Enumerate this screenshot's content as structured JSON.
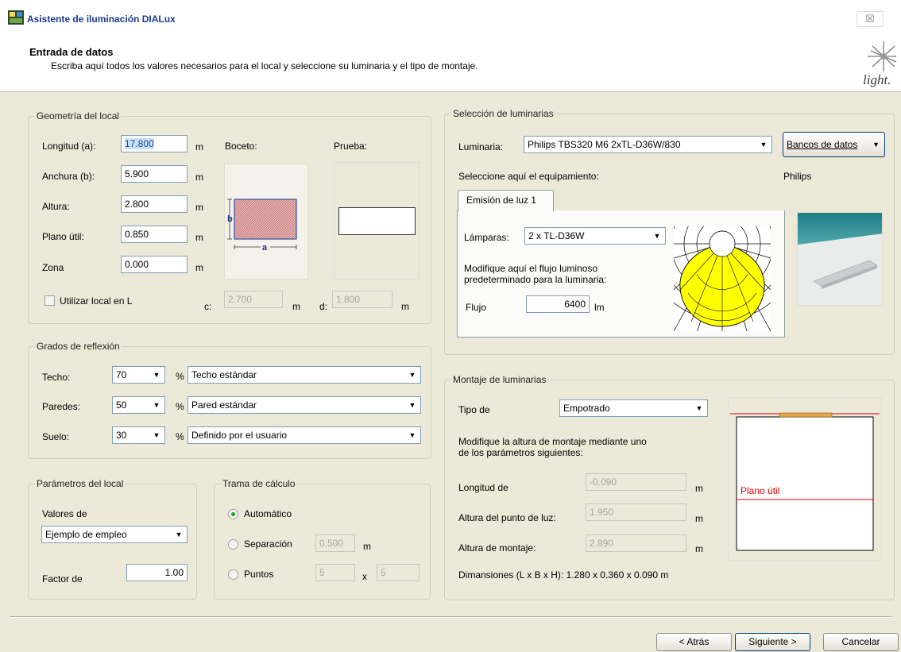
{
  "window": {
    "title": "Asistente de iluminación DIALux",
    "close_glyph": "☒"
  },
  "header": {
    "heading": "Entrada de datos",
    "subheading": "Escriba aquí todos los valores necesarios para el local y seleccione su luminaria y el tipo de montaje.",
    "logo_text": "light."
  },
  "geometry": {
    "legend": "Geometría del local",
    "length_label": "Longitud (a):",
    "length_value": "17.800",
    "length_unit": "m",
    "width_label": "Anchura (b):",
    "width_value": "5.900",
    "width_unit": "m",
    "height_label": "Altura:",
    "height_value": "2.800",
    "height_unit": "m",
    "workplane_label": "Plano útil:",
    "workplane_value": "0.850",
    "workplane_unit": "m",
    "zone_label": "Zona",
    "zone_value": "0.000",
    "zone_unit": "m",
    "sketch_label": "Boceto:",
    "sketch_a": "a",
    "sketch_b": "b",
    "preview_label": "Prueba:",
    "lshape_label": "Utilizar local en L",
    "c_label": "c:",
    "c_value": "2.700",
    "c_unit": "m",
    "d_label": "d:",
    "d_value": "1.800",
    "d_unit": "m"
  },
  "reflection": {
    "legend": "Grados de reflexión",
    "rows": [
      {
        "label": "Techo:",
        "value": "70",
        "pct": "%",
        "preset": "Techo estándar"
      },
      {
        "label": "Paredes:",
        "value": "50",
        "pct": "%",
        "preset": "Pared estándar"
      },
      {
        "label": "Suelo:",
        "value": "30",
        "pct": "%",
        "preset": "Definido por el usuario"
      }
    ]
  },
  "room_params": {
    "legend": "Parámetros del local",
    "values_label": "Valores de",
    "values_select": "Ejemplo de empleo",
    "factor_label": "Factor de",
    "factor_value": "1.00"
  },
  "grid": {
    "legend": "Trama de cálculo",
    "auto_label": "Automático",
    "sep_label": "Separación",
    "sep_value": "0.500",
    "sep_unit": "m",
    "points_label": "Puntos",
    "points_x": "5",
    "points_by": "x",
    "points_y": "5",
    "selected": "Automático"
  },
  "luminaire": {
    "legend": "Selección de luminarias",
    "label": "Luminaria:",
    "selected": "Philips  TBS320 M6 2xTL-D36W/830",
    "db_button": "Bancos de datos",
    "equip_label": "Seleccione aquí el equipamiento:",
    "brand": "Philips",
    "tab": "Emisión de luz 1",
    "lamps_label": "Lámparas:",
    "lamps_value": "2 x TL-D36W",
    "flux_hint_1": "Modifique aquí el flujo luminoso",
    "flux_hint_2": "predeterminado para la luminaria:",
    "flux_label": "Flujo",
    "flux_value": "6400",
    "flux_unit": "lm"
  },
  "mounting": {
    "legend": "Montaje de luminarias",
    "type_label": "Tipo de",
    "type_value": "Empotrado",
    "hint_1": "Modifique la altura de montaje mediante uno",
    "hint_2": "de los parámetros siguientes:",
    "length_label": "Longitud de",
    "length_value": "-0.090",
    "length_unit": "m",
    "lightpoint_label": "Altura del punto de luz:",
    "lightpoint_value": "1.950",
    "lightpoint_unit": "m",
    "mount_label": "Altura de montaje:",
    "mount_value": "2.890",
    "mount_unit": "m",
    "dims": "Dimansiones (L x B x H): 1.280 x 0.360 x 0.090 m",
    "diagram_label": "Plano útil"
  },
  "footer": {
    "back": "< Atrás",
    "next": "Siguiente >",
    "cancel": "Cancelar"
  },
  "colors": {
    "accent_text": "#1a3a8a",
    "button_border": "#003c74",
    "luminaire_yellow": "#ffff00",
    "diagram_red": "#e00000"
  }
}
